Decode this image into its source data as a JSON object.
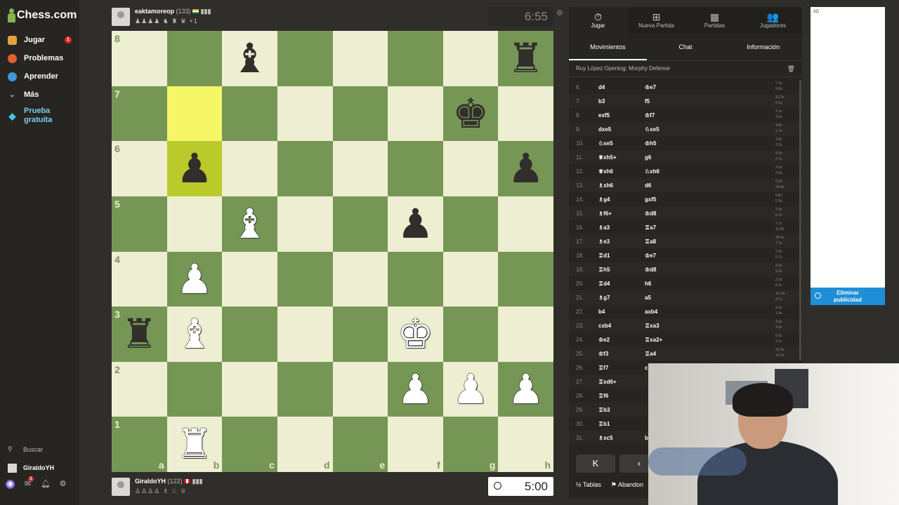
{
  "sidebar": {
    "logo": "Chess.com",
    "items": [
      {
        "label": "Jugar",
        "badge": "1"
      },
      {
        "label": "Problemas"
      },
      {
        "label": "Aprender"
      },
      {
        "label": "Más"
      },
      {
        "label": "Prueba gratuita"
      }
    ],
    "search": "Buscar",
    "user": "GiraldoYH",
    "mail_badge": "1"
  },
  "opponent": {
    "name": "eaktamoreop",
    "rating": "(133)",
    "extra": "+1",
    "clock": "6:55"
  },
  "player": {
    "name": "GiraldoYH",
    "rating": "(122)",
    "clock": "5:00"
  },
  "board": {
    "ranks": [
      "8",
      "7",
      "6",
      "5",
      "4",
      "3",
      "2",
      "1"
    ],
    "files": [
      "a",
      "b",
      "c",
      "d",
      "e",
      "f",
      "g",
      "h"
    ],
    "highlight": [
      "b7",
      "b6"
    ],
    "pieces": [
      {
        "sq": "c8",
        "p": "♝",
        "c": "b"
      },
      {
        "sq": "h8",
        "p": "♜",
        "c": "b"
      },
      {
        "sq": "g7",
        "p": "♚",
        "c": "b"
      },
      {
        "sq": "b6",
        "p": "♟",
        "c": "b"
      },
      {
        "sq": "h6",
        "p": "♟",
        "c": "b"
      },
      {
        "sq": "c5",
        "p": "♝",
        "c": "w"
      },
      {
        "sq": "f5",
        "p": "♟",
        "c": "b"
      },
      {
        "sq": "b4",
        "p": "♟",
        "c": "w"
      },
      {
        "sq": "a3",
        "p": "♜",
        "c": "b"
      },
      {
        "sq": "b3",
        "p": "♝",
        "c": "w"
      },
      {
        "sq": "f3",
        "p": "♚",
        "c": "w"
      },
      {
        "sq": "f2",
        "p": "♟",
        "c": "w"
      },
      {
        "sq": "g2",
        "p": "♟",
        "c": "w"
      },
      {
        "sq": "h2",
        "p": "♟",
        "c": "w"
      },
      {
        "sq": "b1",
        "p": "♜",
        "c": "w"
      }
    ]
  },
  "panel": {
    "tabs": [
      {
        "label": "Jugar",
        "icon": "⏱"
      },
      {
        "label": "Nueva Partida",
        "icon": "⊞"
      },
      {
        "label": "Partidas",
        "icon": "▦"
      },
      {
        "label": "Jugadores",
        "icon": "👥"
      }
    ],
    "subtabs": [
      "Movimientos",
      "Chat",
      "Información"
    ],
    "opening": "Ruy López Opening: Morphy Defense",
    "moves": [
      {
        "n": "6.",
        "w": "d4",
        "b": "♔e7",
        "tw": "7.1s",
        "tb": "9.8s"
      },
      {
        "n": "7.",
        "w": "b3",
        "b": "f5",
        "tw": "13.2s",
        "tb": "5.5s"
      },
      {
        "n": "8.",
        "w": "exf5",
        "b": "♔f7",
        "tw": "1.1s",
        "tb": "3.9s"
      },
      {
        "n": "9.",
        "w": "dxe5",
        "b": "♘xe5",
        "tw": "4.0s",
        "tb": "1.7s"
      },
      {
        "n": "10.",
        "w": "♘xe5",
        "b": "♔h5",
        "tw": "1.8s",
        "tb": "3.3s"
      },
      {
        "n": "11.",
        "w": "♕xh5+",
        "b": "g6",
        "tw": "4.9s",
        "tb": "3.7s"
      },
      {
        "n": "12.",
        "w": "♕xh6",
        "b": "♘xh6",
        "tw": "3.5s",
        "tb": "2.9s"
      },
      {
        "n": "13.",
        "w": "♗xh6",
        "b": "d6",
        "tw": "5.3s",
        "tb": "16.6s"
      },
      {
        "n": "14.",
        "w": "♗g4",
        "b": "gxf5",
        "tw": "6.8s",
        "tb": "5.3s"
      },
      {
        "n": "15.",
        "w": "♗f6+",
        "b": "♔d8",
        "tw": "7.9s",
        "tb": "6.7s"
      },
      {
        "n": "16.",
        "w": "♗a3",
        "b": "♖a7",
        "tw": "7.7s",
        "tb": "12.8s"
      },
      {
        "n": "17.",
        "w": "♗e3",
        "b": "♖a8",
        "tw": "16.4s",
        "tb": "7.7s"
      },
      {
        "n": "18.",
        "w": "♖d1",
        "b": "♔e7",
        "tw": "7.6s",
        "tb": "5.7s"
      },
      {
        "n": "19.",
        "w": "♖h5",
        "b": "♔d8",
        "tw": "4.6s",
        "tb": "5.2s"
      },
      {
        "n": "20.",
        "w": "♖d4",
        "b": "h6",
        "tw": "2.2s",
        "tb": "6.1s"
      },
      {
        "n": "21.",
        "w": "♗g7",
        "b": "a5",
        "tw": "1m 2s",
        "tb": "3.7s"
      },
      {
        "n": "22.",
        "w": "b4",
        "b": "axb4",
        "tw": "4.2s",
        "tb": "1.4s"
      },
      {
        "n": "23.",
        "w": "cxb4",
        "b": "♖xa3",
        "tw": "1.0s",
        "tb": "4.0s"
      },
      {
        "n": "24.",
        "w": "♔e2",
        "b": "♖xa2+",
        "tw": "6.0s",
        "tb": "1.2s"
      },
      {
        "n": "25.",
        "w": "♔f3",
        "b": "♖a4",
        "tw": "12.9s",
        "tb": "12.5s"
      },
      {
        "n": "26.",
        "w": "♖f7",
        "b": "c",
        "tw": "",
        "tb": ""
      },
      {
        "n": "27.",
        "w": "♖xd6+",
        "b": "",
        "tw": "",
        "tb": ""
      },
      {
        "n": "28.",
        "w": "♖f6",
        "b": "",
        "tw": "",
        "tb": ""
      },
      {
        "n": "29.",
        "w": "♖b3",
        "b": "",
        "tw": "",
        "tb": ""
      },
      {
        "n": "30.",
        "w": "♖b1",
        "b": "",
        "tw": "",
        "tb": ""
      },
      {
        "n": "31.",
        "w": "♗xc5",
        "b": "b",
        "tw": "",
        "tb": ""
      }
    ],
    "nav": [
      "K",
      "‹"
    ],
    "draw": "Tablas",
    "resign": "Abandon"
  },
  "ad": {
    "tag": "AD",
    "remove": "Eliminar publicidad"
  }
}
